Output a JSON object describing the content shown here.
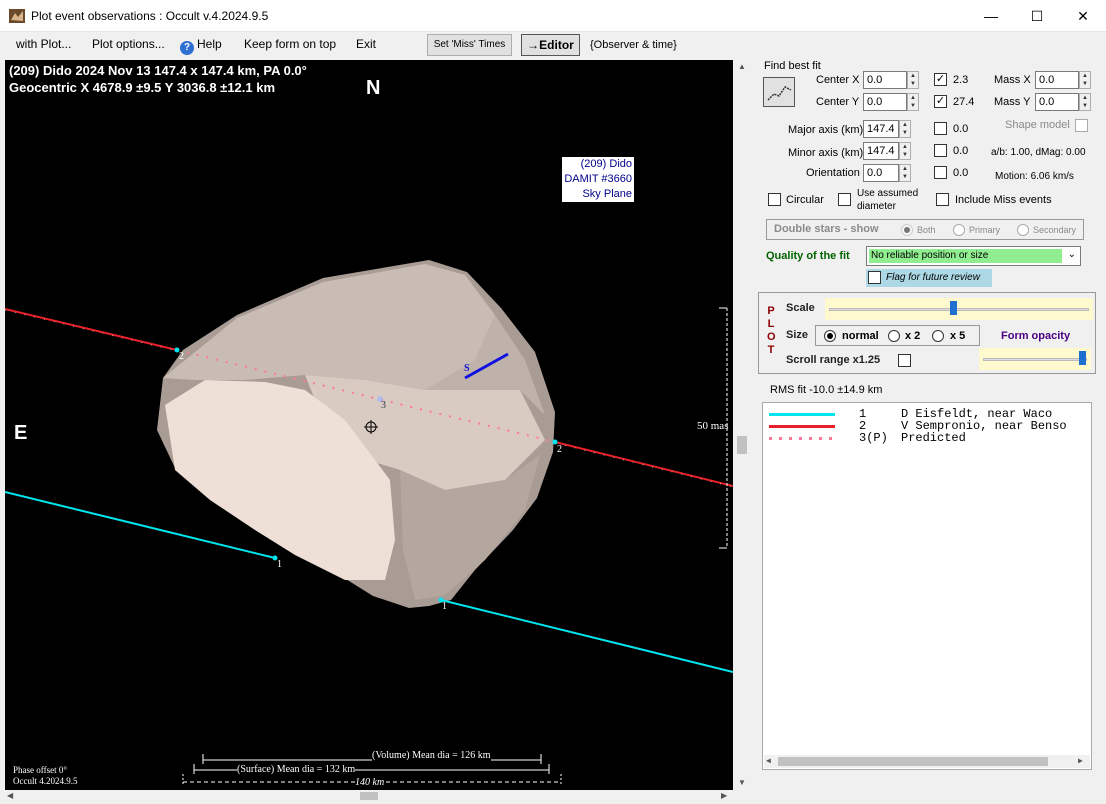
{
  "window": {
    "title": "Plot event observations : Occult v.4.2024.9.5",
    "min": "—",
    "max": "☐",
    "close": "✕"
  },
  "menu": {
    "with_plot": "with Plot...",
    "plot_options": "Plot options...",
    "help": "Help",
    "keep_on_top": "Keep form on top",
    "exit": "Exit",
    "set_miss": "Set 'Miss' Times",
    "editor": "→Editor",
    "observer_time": "{Observer & time}"
  },
  "plot": {
    "header1": "(209) Dido  2024 Nov 13  147.4 x 147.4 km, PA 0.0°",
    "header2": "Geocentric  X  4678.9 ±9.5  Y 3036.8 ±12.1 km",
    "north": "N",
    "east": "E",
    "label_lines": [
      "(209) Dido",
      "DAMIT #3660",
      "Sky Plane"
    ],
    "chord_labels": [
      "2",
      "2",
      "1",
      "1",
      "3"
    ],
    "s_marker": "S",
    "mas_label": "50 mas",
    "volume_dia": "(Volume) Mean dia = 126 km",
    "surface_dia": "(Surface) Mean dia = 132 km",
    "scale_km": "140 km",
    "phase": "Phase offset 0°",
    "version": "Occult 4.2024.9.5"
  },
  "panel": {
    "find_best_fit": "Find best fit",
    "center_x": {
      "label": "Center X",
      "value": "0.0",
      "checked": "✓",
      "val": "2.3"
    },
    "center_y": {
      "label": "Center Y",
      "value": "0.0",
      "checked": "✓",
      "val": "27.4"
    },
    "mass_x": {
      "label": "Mass X",
      "value": "0.0"
    },
    "mass_y": {
      "label": "Mass Y",
      "value": "0.0"
    },
    "major": {
      "label": "Major axis (km)",
      "value": "147.4",
      "val": "0.0"
    },
    "minor": {
      "label": "Minor axis (km)",
      "value": "147.4",
      "val": "0.0"
    },
    "orient": {
      "label": "Orientation",
      "value": "0.0",
      "val": "0.0"
    },
    "shape_model": "Shape model",
    "ab_dmag": "a/b: 1.00, dMag: 0.00",
    "motion": "Motion: 6.06 km/s",
    "circular": "Circular",
    "use_assumed": [
      "Use assumed",
      "diameter"
    ],
    "include_miss": "Include Miss events",
    "double_stars": "Double stars - show",
    "both": "Both",
    "primary": "Primary",
    "secondary": "Secondary",
    "quality_label": "Quality of the fit",
    "quality_value": "No reliable position or size",
    "flag_review": "Flag for future review",
    "plot_letters": [
      "P",
      "L",
      "O",
      "T"
    ],
    "scale": "Scale",
    "size": "Size",
    "normal": "normal",
    "x2": "x 2",
    "x5": "x 5",
    "form_opacity": "Form opacity",
    "scroll_range": "Scroll range x1.25",
    "rms": "RMS fit -10.0 ±14.9 km"
  },
  "legend": [
    {
      "num": "1",
      "name": "D Eisfeldt, near Waco",
      "color": "#00ffff",
      "style": "solid"
    },
    {
      "num": "2",
      "name": "V Sempronio, near Benso",
      "color": "#e8202a",
      "style": "solid"
    },
    {
      "num": "3(P)",
      "name": "Predicted",
      "color": "#ff7799",
      "style": "dotted"
    }
  ]
}
